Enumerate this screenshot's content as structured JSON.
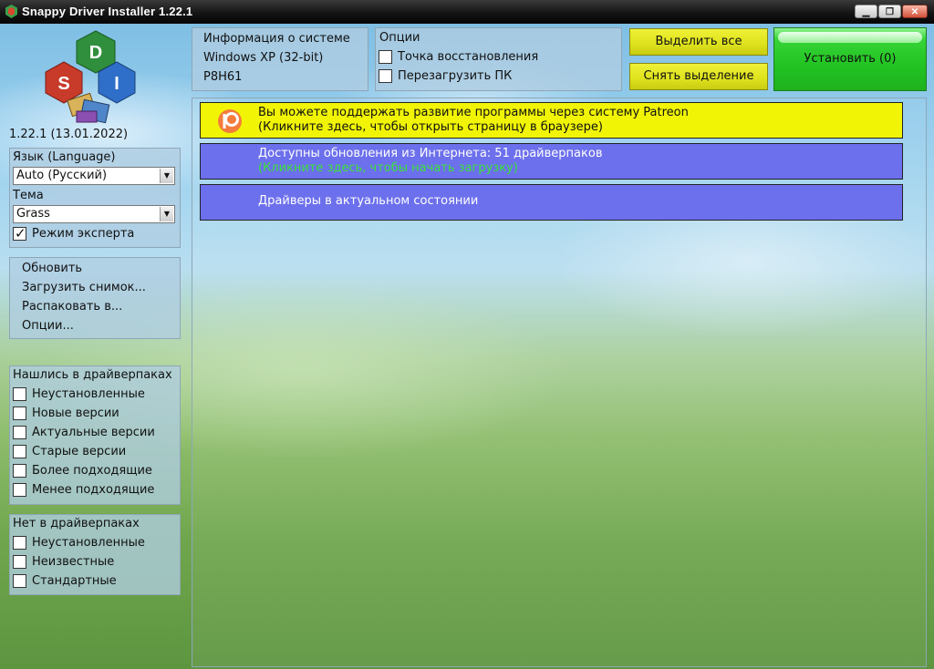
{
  "window": {
    "title": "Snappy Driver Installer 1.22.1"
  },
  "logo": {
    "letters": [
      "D",
      "S",
      "I"
    ]
  },
  "version": "1.22.1 (13.01.2022)",
  "settings": {
    "language_label": "Язык (Language)",
    "language_value": "Auto (Русский)",
    "theme_label": "Тема",
    "theme_value": "Grass",
    "expert_label": "Режим эксперта",
    "expert_checked": true
  },
  "actions": [
    "Обновить",
    "Загрузить снимок...",
    "Распаковать в...",
    "Опции..."
  ],
  "found_in_packs": {
    "title": "Нашлись в драйверпаках",
    "items": [
      "Неустановленные",
      "Новые версии",
      "Актуальные версии",
      "Старые версии",
      "Более подходящие",
      "Менее подходящие"
    ]
  },
  "not_in_packs": {
    "title": "Нет в драйверпаках",
    "items": [
      "Неустановленные",
      "Неизвестные",
      "Стандартные"
    ]
  },
  "sysinfo": {
    "title": "Информация о системе",
    "os": "Windows XP (32-bit)",
    "board": "P8H61"
  },
  "options": {
    "title": "Опции",
    "restore_point": "Точка восстановления",
    "reboot": "Перезагрузить ПК"
  },
  "buttons": {
    "select_all": "Выделить все",
    "deselect": "Снять выделение",
    "install": "Установить (0)"
  },
  "messages": {
    "patreon_line1": "Вы можете поддержать развитие программы через систему Patreon",
    "patreon_line2": "(Кликните здесь, чтобы открыть страницу в браузере)",
    "updates_line1": "Доступны обновления из Интернета: 51 драйверпаков",
    "updates_line2": "(Кликните здесь, чтобы начать загрузку)",
    "uptodate": "Драйверы в актуальном состоянии"
  },
  "colors": {
    "patreon_bg": "#f1f505",
    "info_bg": "#6c70ec",
    "info_text": "#ffffff",
    "updates_hint": "#3be03b",
    "install_green": "#22c322",
    "button_yellow": "#dfe41e"
  }
}
